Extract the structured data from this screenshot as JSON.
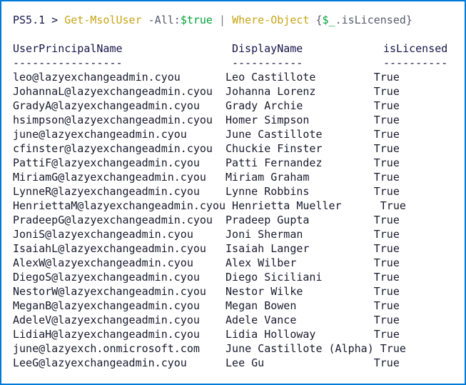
{
  "window": {
    "border_color": "#007ad9",
    "background_color": "#ffffff"
  },
  "prompt_line": {
    "prompt": "PS5.1 > ",
    "cmdlet_1": "Get-MsolUser",
    "space_1": " ",
    "param_1": "-All:",
    "value_1": "$true",
    "pipe": " | ",
    "cmdlet_2": "Where-Object",
    "brace_open": " {",
    "variable": "$_",
    "property": ".isLicensed",
    "brace_close": "}",
    "full_text": "PS5.1 > Get-MsolUser -All:$true | Where-Object {$_.isLicensed}"
  },
  "table": {
    "headers": {
      "user_principal_name": "UserPrincipalName",
      "display_name": "DisplayName",
      "is_licensed": "isLicensed"
    },
    "rules": {
      "user_principal_name": "-----------------",
      "display_name": "-----------",
      "is_licensed": "----------"
    },
    "rows": [
      {
        "upn": "leo@lazyexchangeadmin.cyou",
        "display": "Leo Castillote",
        "licensed": "True"
      },
      {
        "upn": "JohannaL@lazyexchangeadmin.cyou",
        "display": "Johanna Lorenz",
        "licensed": "True"
      },
      {
        "upn": "GradyA@lazyexchangeadmin.cyou",
        "display": "Grady Archie",
        "licensed": "True"
      },
      {
        "upn": "hsimpson@lazyexchangeadmin.cyou",
        "display": "Homer Simpson",
        "licensed": "True"
      },
      {
        "upn": "june@lazyexchangeadmin.cyou",
        "display": "June Castillote",
        "licensed": "True"
      },
      {
        "upn": "cfinster@lazyexchangeadmin.cyou",
        "display": "Chuckie Finster",
        "licensed": "True"
      },
      {
        "upn": "PattiF@lazyexchangeadmin.cyou",
        "display": "Patti Fernandez",
        "licensed": "True"
      },
      {
        "upn": "MiriamG@lazyexchangeadmin.cyou",
        "display": "Miriam Graham",
        "licensed": "True"
      },
      {
        "upn": "LynneR@lazyexchangeadmin.cyou",
        "display": "Lynne Robbins",
        "licensed": "True"
      },
      {
        "upn": "HenriettaM@lazyexchangeadmin.cyou",
        "display": "Henrietta Mueller",
        "licensed": "True"
      },
      {
        "upn": "PradeepG@lazyexchangeadmin.cyou",
        "display": "Pradeep Gupta",
        "licensed": "True"
      },
      {
        "upn": "JoniS@lazyexchangeadmin.cyou",
        "display": "Joni Sherman",
        "licensed": "True"
      },
      {
        "upn": "IsaiahL@lazyexchangeadmin.cyou",
        "display": "Isaiah Langer",
        "licensed": "True"
      },
      {
        "upn": "AlexW@lazyexchangeadmin.cyou",
        "display": "Alex Wilber",
        "licensed": "True"
      },
      {
        "upn": "DiegoS@lazyexchangeadmin.cyou",
        "display": "Diego Siciliani",
        "licensed": "True"
      },
      {
        "upn": "NestorW@lazyexchangeadmin.cyou",
        "display": "Nestor Wilke",
        "licensed": "True"
      },
      {
        "upn": "MeganB@lazyexchangeadmin.cyou",
        "display": "Megan Bowen",
        "licensed": "True"
      },
      {
        "upn": "AdeleV@lazyexchangeadmin.cyou",
        "display": "Adele Vance",
        "licensed": "True"
      },
      {
        "upn": "LidiaH@lazyexchangeadmin.cyou",
        "display": "Lidia Holloway",
        "licensed": "True"
      },
      {
        "upn": "june@lazyexch.onmicrosoft.com",
        "display": "June Castillote (Alpha)",
        "licensed": "True"
      },
      {
        "upn": "LeeG@lazyexchangeadmin.cyou",
        "display": "Lee Gu",
        "licensed": "True"
      }
    ]
  }
}
